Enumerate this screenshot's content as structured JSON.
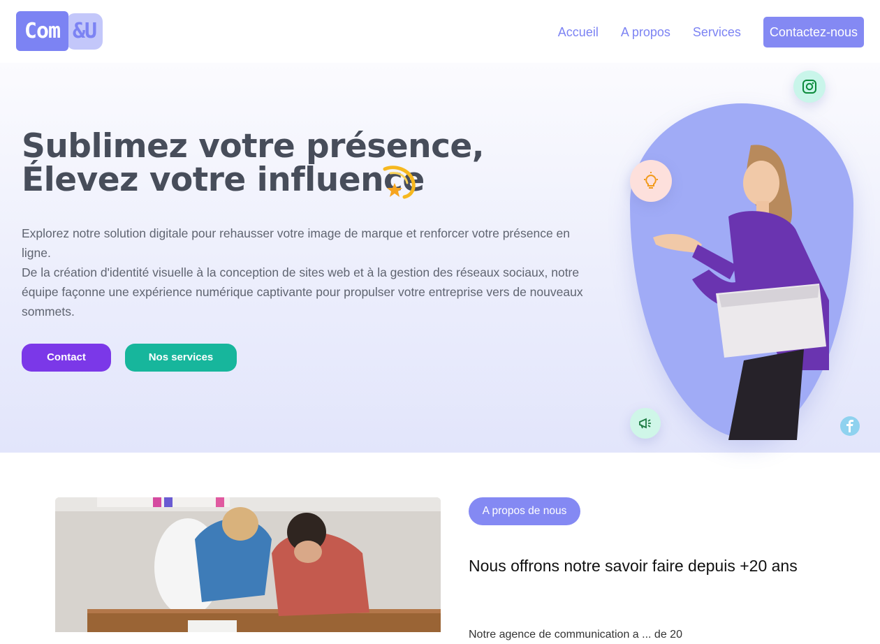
{
  "header": {
    "logo_part1": "Com",
    "logo_part2": "&U",
    "nav": [
      "Accueil",
      "A propos",
      "Services"
    ],
    "cta": "Contactez-nous"
  },
  "hero": {
    "title_line1": "Sublimez votre présence,",
    "title_line2": "Élevez votre influence",
    "paragraph_line1": "Explorez notre solution digitale pour rehausser votre image de marque et renforcer votre présence en ligne.",
    "paragraph_line2": "De la création d'identité visuelle à la conception de sites web et à la gestion des réseaux sociaux, notre équipe façonne une expérience numérique captivante pour propulser votre entreprise vers de nouveaux sommets.",
    "btn_contact": "Contact",
    "btn_services": "Nos services",
    "icons": [
      "instagram-icon",
      "lightbulb-icon",
      "megaphone-icon",
      "facebook-icon",
      "comet-emoji"
    ]
  },
  "about": {
    "badge": "A propos de nous",
    "title": "Nous offrons notre savoir faire depuis +20 ans",
    "text_partial": "Notre agence de communication a ... de 20"
  },
  "colors": {
    "accent": "#8489f3",
    "primary_button": "#7b38e8",
    "secondary_button": "#17b69c",
    "heading": "#474d5a"
  }
}
